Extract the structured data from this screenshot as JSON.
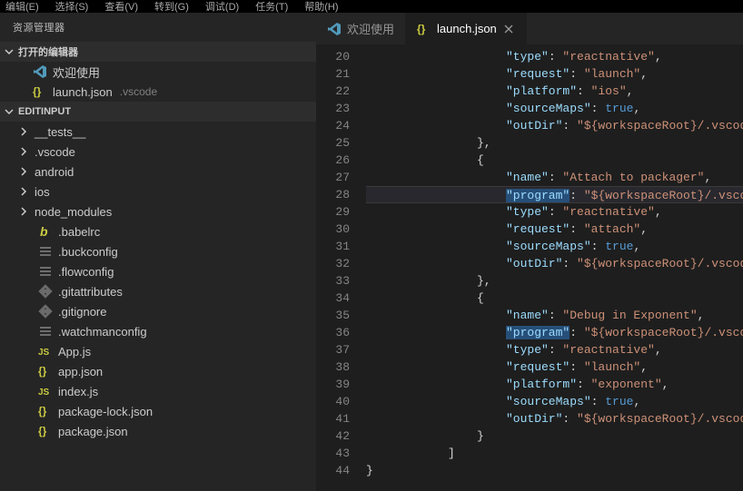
{
  "menubar": [
    "编辑(E)",
    "选择(S)",
    "查看(V)",
    "转到(G)",
    "调试(D)",
    "任务(T)",
    "帮助(H)"
  ],
  "sidebar": {
    "title": "资源管理器",
    "openEditors": {
      "label": "打开的编辑器",
      "items": [
        {
          "icon": "vscode-icon",
          "label": "欢迎使用"
        },
        {
          "icon": "json-icon",
          "label": "launch.json",
          "path": ".vscode"
        }
      ]
    },
    "project": {
      "label": "EDITINPUT",
      "items": [
        {
          "kind": "folder",
          "label": "__tests__"
        },
        {
          "kind": "folder",
          "label": ".vscode"
        },
        {
          "kind": "folder",
          "label": "android"
        },
        {
          "kind": "folder",
          "label": "ios"
        },
        {
          "kind": "folder",
          "label": "node_modules"
        },
        {
          "kind": "file",
          "icon": "babel-icon",
          "label": ".babelrc"
        },
        {
          "kind": "file",
          "icon": "config-icon",
          "label": ".buckconfig"
        },
        {
          "kind": "file",
          "icon": "config-icon",
          "label": ".flowconfig"
        },
        {
          "kind": "file",
          "icon": "git-icon",
          "label": ".gitattributes"
        },
        {
          "kind": "file",
          "icon": "git-icon",
          "label": ".gitignore"
        },
        {
          "kind": "file",
          "icon": "config-icon",
          "label": ".watchmanconfig"
        },
        {
          "kind": "file",
          "icon": "js-icon",
          "label": "App.js"
        },
        {
          "kind": "file",
          "icon": "json-icon",
          "label": "app.json"
        },
        {
          "kind": "file",
          "icon": "js-icon",
          "label": "index.js"
        },
        {
          "kind": "file",
          "icon": "json-icon",
          "label": "package-lock.json"
        },
        {
          "kind": "file",
          "icon": "json-icon",
          "label": "package.json"
        }
      ]
    }
  },
  "tabs": [
    {
      "icon": "vscode-icon",
      "label": "欢迎使用",
      "active": false
    },
    {
      "icon": "json-icon",
      "label": "launch.json",
      "active": true
    }
  ],
  "code": {
    "startLine": 20,
    "currentLine": 28,
    "lines": [
      {
        "n": 20,
        "i": 3,
        "t": [
          [
            "key",
            "\"type\""
          ],
          [
            "punc",
            ": "
          ],
          [
            "str",
            "\"reactnative\""
          ],
          [
            "punc",
            ","
          ]
        ]
      },
      {
        "n": 21,
        "i": 3,
        "t": [
          [
            "key",
            "\"request\""
          ],
          [
            "punc",
            ": "
          ],
          [
            "str",
            "\"launch\""
          ],
          [
            "punc",
            ","
          ]
        ]
      },
      {
        "n": 22,
        "i": 3,
        "t": [
          [
            "key",
            "\"platform\""
          ],
          [
            "punc",
            ": "
          ],
          [
            "str",
            "\"ios\""
          ],
          [
            "punc",
            ","
          ]
        ]
      },
      {
        "n": 23,
        "i": 3,
        "t": [
          [
            "key",
            "\"sourceMaps\""
          ],
          [
            "punc",
            ": "
          ],
          [
            "bool",
            "true"
          ],
          [
            "punc",
            ","
          ]
        ]
      },
      {
        "n": 24,
        "i": 3,
        "t": [
          [
            "key",
            "\"outDir\""
          ],
          [
            "punc",
            ": "
          ],
          [
            "str",
            "\"${workspaceRoot}/.vscode/.react\""
          ]
        ]
      },
      {
        "n": 25,
        "i": 2,
        "t": [
          [
            "punc",
            "},"
          ]
        ]
      },
      {
        "n": 26,
        "i": 2,
        "t": [
          [
            "punc",
            "{"
          ]
        ]
      },
      {
        "n": 27,
        "i": 3,
        "t": [
          [
            "key",
            "\"name\""
          ],
          [
            "punc",
            ": "
          ],
          [
            "str",
            "\"Attach to packager\""
          ],
          [
            "punc",
            ","
          ]
        ]
      },
      {
        "n": 28,
        "i": 3,
        "t": [
          [
            "keysel",
            "\"program\""
          ],
          [
            "punc",
            ": "
          ],
          [
            "str",
            "\"${workspaceRoot}/.vscode/launch\""
          ]
        ]
      },
      {
        "n": 29,
        "i": 3,
        "t": [
          [
            "key",
            "\"type\""
          ],
          [
            "punc",
            ": "
          ],
          [
            "str",
            "\"reactnative\""
          ],
          [
            "punc",
            ","
          ]
        ]
      },
      {
        "n": 30,
        "i": 3,
        "t": [
          [
            "key",
            "\"request\""
          ],
          [
            "punc",
            ": "
          ],
          [
            "str",
            "\"attach\""
          ],
          [
            "punc",
            ","
          ]
        ]
      },
      {
        "n": 31,
        "i": 3,
        "t": [
          [
            "key",
            "\"sourceMaps\""
          ],
          [
            "punc",
            ": "
          ],
          [
            "bool",
            "true"
          ],
          [
            "punc",
            ","
          ]
        ]
      },
      {
        "n": 32,
        "i": 3,
        "t": [
          [
            "key",
            "\"outDir\""
          ],
          [
            "punc",
            ": "
          ],
          [
            "str",
            "\"${workspaceRoot}/.vscode/.react\""
          ]
        ]
      },
      {
        "n": 33,
        "i": 2,
        "t": [
          [
            "punc",
            "},"
          ]
        ]
      },
      {
        "n": 34,
        "i": 2,
        "t": [
          [
            "punc",
            "{"
          ]
        ]
      },
      {
        "n": 35,
        "i": 3,
        "t": [
          [
            "key",
            "\"name\""
          ],
          [
            "punc",
            ": "
          ],
          [
            "str",
            "\"Debug in Exponent\""
          ],
          [
            "punc",
            ","
          ]
        ]
      },
      {
        "n": 36,
        "i": 3,
        "t": [
          [
            "keysel",
            "\"program\""
          ],
          [
            "punc",
            ": "
          ],
          [
            "str",
            "\"${workspaceRoot}/.vscode/launch\""
          ]
        ]
      },
      {
        "n": 37,
        "i": 3,
        "t": [
          [
            "key",
            "\"type\""
          ],
          [
            "punc",
            ": "
          ],
          [
            "str",
            "\"reactnative\""
          ],
          [
            "punc",
            ","
          ]
        ]
      },
      {
        "n": 38,
        "i": 3,
        "t": [
          [
            "key",
            "\"request\""
          ],
          [
            "punc",
            ": "
          ],
          [
            "str",
            "\"launch\""
          ],
          [
            "punc",
            ","
          ]
        ]
      },
      {
        "n": 39,
        "i": 3,
        "t": [
          [
            "key",
            "\"platform\""
          ],
          [
            "punc",
            ": "
          ],
          [
            "str",
            "\"exponent\""
          ],
          [
            "punc",
            ","
          ]
        ]
      },
      {
        "n": 40,
        "i": 3,
        "t": [
          [
            "key",
            "\"sourceMaps\""
          ],
          [
            "punc",
            ": "
          ],
          [
            "bool",
            "true"
          ],
          [
            "punc",
            ","
          ]
        ]
      },
      {
        "n": 41,
        "i": 3,
        "t": [
          [
            "key",
            "\"outDir\""
          ],
          [
            "punc",
            ": "
          ],
          [
            "str",
            "\"${workspaceRoot}/.vscode/.react\""
          ]
        ]
      },
      {
        "n": 42,
        "i": 2,
        "t": [
          [
            "punc",
            "}"
          ]
        ]
      },
      {
        "n": 43,
        "i": 1,
        "t": [
          [
            "punc",
            "]"
          ]
        ]
      },
      {
        "n": 44,
        "i": 0,
        "t": [
          [
            "punc",
            "}"
          ]
        ]
      }
    ]
  }
}
